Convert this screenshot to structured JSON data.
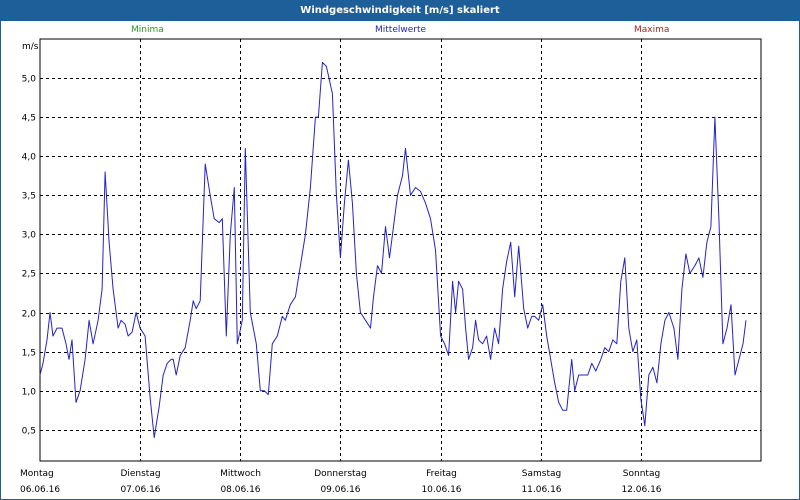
{
  "window": {
    "title": "Windgeschwindigkeit [m/s] skaliert"
  },
  "legend": {
    "minima": "Minima",
    "mittelwerte": "Mittelwerte",
    "maxima": "Maxima"
  },
  "colors": {
    "title_bar": "#1f5f99",
    "minima": "#2a9a2a",
    "mittelwerte": "#2323c8",
    "maxima": "#b02020",
    "series": "#2323c8",
    "grid": "#000000"
  },
  "chart_data": {
    "type": "line",
    "title": "Windgeschwindigkeit [m/s] skaliert",
    "ylabel": "m/s",
    "ylim": [
      0.1,
      5.5
    ],
    "y_ticks": [
      "0,5",
      "1,0",
      "1,5",
      "2,0",
      "2,5",
      "3,0",
      "3,5",
      "4,0",
      "4,5",
      "5,0"
    ],
    "y_tick_values": [
      0.5,
      1.0,
      1.5,
      2.0,
      2.5,
      3.0,
      3.5,
      4.0,
      4.5,
      5.0
    ],
    "x_days": [
      {
        "day": "Montag",
        "date": "06.06.16"
      },
      {
        "day": "Dienstag",
        "date": "07.06.16"
      },
      {
        "day": "Mittwoch",
        "date": "08.06.16"
      },
      {
        "day": "Donnerstag",
        "date": "09.06.16"
      },
      {
        "day": "Freitag",
        "date": "10.06.16"
      },
      {
        "day": "Samstag",
        "date": "11.06.16"
      },
      {
        "day": "Sonntag",
        "date": "12.06.16"
      }
    ],
    "xlim_days": [
      0,
      7.2
    ],
    "grid": true,
    "series": [
      {
        "points": [
          [
            0.0,
            1.2
          ],
          [
            0.03,
            1.35
          ],
          [
            0.07,
            1.65
          ],
          [
            0.1,
            2.0
          ],
          [
            0.13,
            1.7
          ],
          [
            0.17,
            1.8
          ],
          [
            0.22,
            1.8
          ],
          [
            0.26,
            1.6
          ],
          [
            0.29,
            1.4
          ],
          [
            0.32,
            1.65
          ],
          [
            0.36,
            0.85
          ],
          [
            0.4,
            1.0
          ],
          [
            0.45,
            1.4
          ],
          [
            0.49,
            1.9
          ],
          [
            0.53,
            1.6
          ],
          [
            0.58,
            1.9
          ],
          [
            0.62,
            2.3
          ],
          [
            0.65,
            3.8
          ],
          [
            0.69,
            2.9
          ],
          [
            0.73,
            2.3
          ],
          [
            0.78,
            1.8
          ],
          [
            0.81,
            1.9
          ],
          [
            0.85,
            1.85
          ],
          [
            0.88,
            1.7
          ],
          [
            0.92,
            1.75
          ],
          [
            0.96,
            2.0
          ],
          [
            1.0,
            1.8
          ],
          [
            1.05,
            1.7
          ],
          [
            1.1,
            0.9
          ],
          [
            1.14,
            0.4
          ],
          [
            1.19,
            0.8
          ],
          [
            1.23,
            1.2
          ],
          [
            1.27,
            1.35
          ],
          [
            1.31,
            1.4
          ],
          [
            1.33,
            1.4
          ],
          [
            1.36,
            1.2
          ],
          [
            1.4,
            1.45
          ],
          [
            1.45,
            1.55
          ],
          [
            1.5,
            1.9
          ],
          [
            1.53,
            2.15
          ],
          [
            1.56,
            2.05
          ],
          [
            1.6,
            2.15
          ],
          [
            1.65,
            3.9
          ],
          [
            1.7,
            3.5
          ],
          [
            1.74,
            3.2
          ],
          [
            1.79,
            3.15
          ],
          [
            1.82,
            3.2
          ],
          [
            1.86,
            1.7
          ],
          [
            1.9,
            3.0
          ],
          [
            1.94,
            3.6
          ],
          [
            1.97,
            1.6
          ],
          [
            2.02,
            1.9
          ],
          [
            2.05,
            4.1
          ],
          [
            2.1,
            2.0
          ],
          [
            2.16,
            1.6
          ],
          [
            2.2,
            1.0
          ],
          [
            2.24,
            1.0
          ],
          [
            2.28,
            0.95
          ],
          [
            2.32,
            1.6
          ],
          [
            2.37,
            1.7
          ],
          [
            2.42,
            1.95
          ],
          [
            2.45,
            1.9
          ],
          [
            2.5,
            2.1
          ],
          [
            2.55,
            2.2
          ],
          [
            2.6,
            2.6
          ],
          [
            2.65,
            3.0
          ],
          [
            2.7,
            3.6
          ],
          [
            2.75,
            4.5
          ],
          [
            2.78,
            4.5
          ],
          [
            2.82,
            5.2
          ],
          [
            2.86,
            5.15
          ],
          [
            2.92,
            4.8
          ],
          [
            2.96,
            3.5
          ],
          [
            3.0,
            2.7
          ],
          [
            3.04,
            3.4
          ],
          [
            3.08,
            3.95
          ],
          [
            3.12,
            3.4
          ],
          [
            3.16,
            2.5
          ],
          [
            3.2,
            2.0
          ],
          [
            3.25,
            1.9
          ],
          [
            3.3,
            1.8
          ],
          [
            3.33,
            2.2
          ],
          [
            3.37,
            2.6
          ],
          [
            3.41,
            2.5
          ],
          [
            3.45,
            3.1
          ],
          [
            3.49,
            2.7
          ],
          [
            3.53,
            3.1
          ],
          [
            3.57,
            3.5
          ],
          [
            3.62,
            3.75
          ],
          [
            3.65,
            4.1
          ],
          [
            3.7,
            3.5
          ],
          [
            3.75,
            3.6
          ],
          [
            3.8,
            3.55
          ],
          [
            3.85,
            3.4
          ],
          [
            3.9,
            3.2
          ],
          [
            3.95,
            2.8
          ],
          [
            4.0,
            1.7
          ],
          [
            4.04,
            1.6
          ],
          [
            4.08,
            1.45
          ],
          [
            4.12,
            2.4
          ],
          [
            4.15,
            2.0
          ],
          [
            4.18,
            2.4
          ],
          [
            4.22,
            2.3
          ],
          [
            4.25,
            1.8
          ],
          [
            4.28,
            1.4
          ],
          [
            4.32,
            1.55
          ],
          [
            4.35,
            1.9
          ],
          [
            4.38,
            1.65
          ],
          [
            4.42,
            1.6
          ],
          [
            4.46,
            1.7
          ],
          [
            4.5,
            1.4
          ],
          [
            4.54,
            1.8
          ],
          [
            4.58,
            1.6
          ],
          [
            4.62,
            2.3
          ],
          [
            4.66,
            2.65
          ],
          [
            4.7,
            2.9
          ],
          [
            4.74,
            2.2
          ],
          [
            4.78,
            2.85
          ],
          [
            4.83,
            2.05
          ],
          [
            4.87,
            1.8
          ],
          [
            4.91,
            1.95
          ],
          [
            4.94,
            1.95
          ],
          [
            4.98,
            1.9
          ],
          [
            5.02,
            2.1
          ],
          [
            5.06,
            1.7
          ],
          [
            5.1,
            1.4
          ],
          [
            5.14,
            1.1
          ],
          [
            5.18,
            0.85
          ],
          [
            5.22,
            0.75
          ],
          [
            5.26,
            0.75
          ],
          [
            5.31,
            1.4
          ],
          [
            5.34,
            1.0
          ],
          [
            5.38,
            1.2
          ],
          [
            5.42,
            1.2
          ],
          [
            5.47,
            1.2
          ],
          [
            5.51,
            1.35
          ],
          [
            5.55,
            1.25
          ],
          [
            5.6,
            1.4
          ],
          [
            5.64,
            1.55
          ],
          [
            5.68,
            1.5
          ],
          [
            5.72,
            1.65
          ],
          [
            5.76,
            1.6
          ],
          [
            5.8,
            2.4
          ],
          [
            5.84,
            2.7
          ],
          [
            5.88,
            1.8
          ],
          [
            5.92,
            1.5
          ],
          [
            5.96,
            1.65
          ],
          [
            6.0,
            0.9
          ],
          [
            6.04,
            0.55
          ],
          [
            6.08,
            1.2
          ],
          [
            6.12,
            1.3
          ],
          [
            6.16,
            1.1
          ],
          [
            6.2,
            1.6
          ],
          [
            6.24,
            1.9
          ],
          [
            6.28,
            2.0
          ],
          [
            6.33,
            1.8
          ],
          [
            6.37,
            1.4
          ],
          [
            6.41,
            2.3
          ],
          [
            6.45,
            2.75
          ],
          [
            6.49,
            2.5
          ],
          [
            6.54,
            2.6
          ],
          [
            6.58,
            2.7
          ],
          [
            6.62,
            2.45
          ],
          [
            6.66,
            2.9
          ],
          [
            6.7,
            3.1
          ],
          [
            6.74,
            4.5
          ],
          [
            6.78,
            3.2
          ],
          [
            6.82,
            1.6
          ],
          [
            6.86,
            1.8
          ],
          [
            6.9,
            2.1
          ],
          [
            6.94,
            1.2
          ],
          [
            6.98,
            1.4
          ],
          [
            7.02,
            1.6
          ],
          [
            7.05,
            1.9
          ]
        ]
      }
    ]
  }
}
